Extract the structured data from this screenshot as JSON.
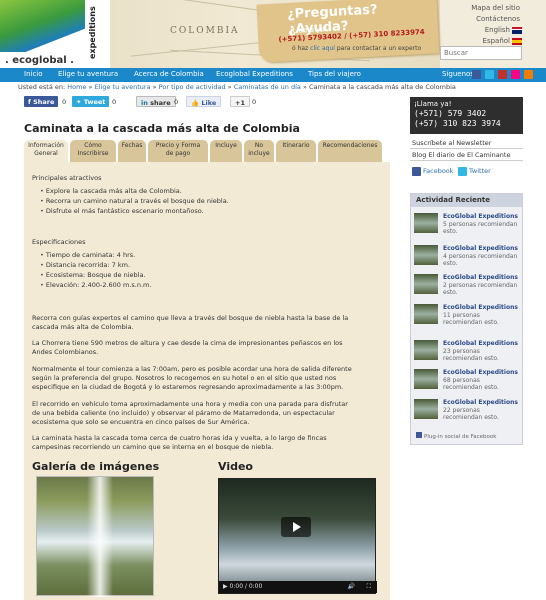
{
  "header": {
    "logo_name": ". ecoglobal .",
    "logo_tagline": "expeditions",
    "map_label": "COLOMBIA",
    "tag_question": "¿Preguntas? ¿Ayuda?",
    "tag_call": "¡Llama ya!",
    "tag_phones": "(+571) 5793402 / (+57) 310 8233974",
    "contact_text_pre": "ó haz",
    "contact_link": "clic aquí",
    "contact_text_post": "para contactar a un experto",
    "top_links": [
      "Mapa del sitio",
      "Contáctenos"
    ],
    "languages": [
      "English",
      "Español"
    ],
    "search_placeholder": "Buscar"
  },
  "nav": {
    "items": [
      "Inicio",
      "Elige tu aventura",
      "Acerca de Colombia",
      "Ecoglobal Expeditions",
      "Tips del viajero"
    ],
    "follow_label": "Síguenos",
    "social_icons": [
      "facebook-icon",
      "twitter-icon",
      "youtube-icon",
      "flickr-icon",
      "blog-icon"
    ]
  },
  "breadcrumb": {
    "prefix": "Usted está en:",
    "items": [
      "Home",
      "Elige tu aventura",
      "Por tipo de actividad",
      "Caminatas de un día"
    ],
    "current": "Caminata a la cascada más alta de Colombia",
    "separator": "»"
  },
  "share": {
    "facebook_label": "Share",
    "facebook_count": "0",
    "tweet_label": "Tweet",
    "tweet_count": "0",
    "linkedin_label": "share",
    "linkedin_count": "0",
    "like_label": "Like",
    "plusone_label": "+1",
    "plusone_count": "0"
  },
  "page_title": "Caminata a la cascada más alta de Colombia",
  "tabs": [
    {
      "line1": "Información",
      "line2": "General"
    },
    {
      "line1": "Cómo",
      "line2": "Inscribirse"
    },
    {
      "line1": "Fechas",
      "line2": ""
    },
    {
      "line1": "Precio y Forma",
      "line2": "de pago"
    },
    {
      "line1": "Incluye",
      "line2": ""
    },
    {
      "line1": "No",
      "line2": "incluye"
    },
    {
      "line1": "Itinerario",
      "line2": ""
    },
    {
      "line1": "Recomendaciones",
      "line2": ""
    }
  ],
  "content": {
    "attractions_heading": "Principales atractivos",
    "attractions": [
      "Explore la cascada más alta de Colombia.",
      "Recorra un camino natural a través el bosque de niebla.",
      "Disfrute el más fantástico escenario montañoso."
    ],
    "specs_heading": "Especificaciones",
    "specs": [
      "Tiempo de caminata: 4 hrs.",
      "Distancia recorrida: 7 km.",
      "Ecosistema: Bosque de niebla.",
      "Elevación: 2.400-2.600 m.s.n.m."
    ],
    "para1_line1": "Recorra con guías expertos el camino que lleva a través del bosque de niebla hasta la base de la",
    "para1_line2": "cascada más alta de Colombia.",
    "para2_line1": "La Chorrera tiene 590 metros de altura y cae desde la cima de impresionantes peñascos en los",
    "para2_line2": "Andes Colombianos.",
    "para3_line1": "Normalmente el tour comienza a las 7:00am, pero es posible acordar una hora de salida diferente",
    "para3_line2": "según la preferencia del grupo. Nosotros lo recogemos en su hotel o en el sitio que usted nos",
    "para3_line3": "especifique en la ciudad de Bogotá y lo estaremos regresando aproximadamente a las 3:00pm.",
    "para4_line1": "El recorrido en vehículo toma aproximadamente una hora y media con una parada para disfrutar",
    "para4_line2": "de una bebida caliente (no incluido) y observar el páramo de Matarredonda, un espectacular",
    "para4_line3": "ecosistema que solo se encuentra en cinco países de Sur América.",
    "para5_line1": "La caminata hasta la cascada toma cerca de cuatro horas ida y vuelta, a lo largo de fincas",
    "para5_line2": "campesinas recorriendo un camino que se interna en el bosque de niebla.",
    "gallery_heading": "Galería de imágenes",
    "video_heading": "Video",
    "video_time": "0:00 / 0:00"
  },
  "sidebar": {
    "call_label": "¡Llama ya!",
    "phone1": "(+571) 579 3402",
    "phone2": "(+57) 310 823 3974",
    "newsletter": "Suscríbete al Newsletter",
    "blog": "Blog El diario de El Caminante",
    "facebook": "Facebook",
    "twitter": "Twitter",
    "activity_heading": "Actividad Reciente",
    "activity": [
      {
        "name": "EcoGlobal Expeditions",
        "text": "5 personas recomiendan esto."
      },
      {
        "name": "EcoGlobal Expeditions",
        "text": "4 personas recomiendan esto."
      },
      {
        "name": "EcoGlobal Expeditions",
        "text": "2 personas recomiendan esto."
      },
      {
        "name": "EcoGlobal Expeditions",
        "text": "11 personas recomiendan esto."
      },
      {
        "name": "EcoGlobal Expeditions",
        "text": "23 personas recomiendan esto."
      },
      {
        "name": "EcoGlobal Expeditions",
        "text": "68 personas recomiendan esto."
      },
      {
        "name": "EcoGlobal Expeditions",
        "text": "22 personas recomiendan esto."
      }
    ],
    "plugin_label": "Plug-in social de Facebook"
  },
  "colors": {
    "nav_blue": "#1a88c9",
    "content_beige": "#f3ead5",
    "tab_tan": "#d8c59a",
    "link_blue": "#2a6fb0"
  }
}
